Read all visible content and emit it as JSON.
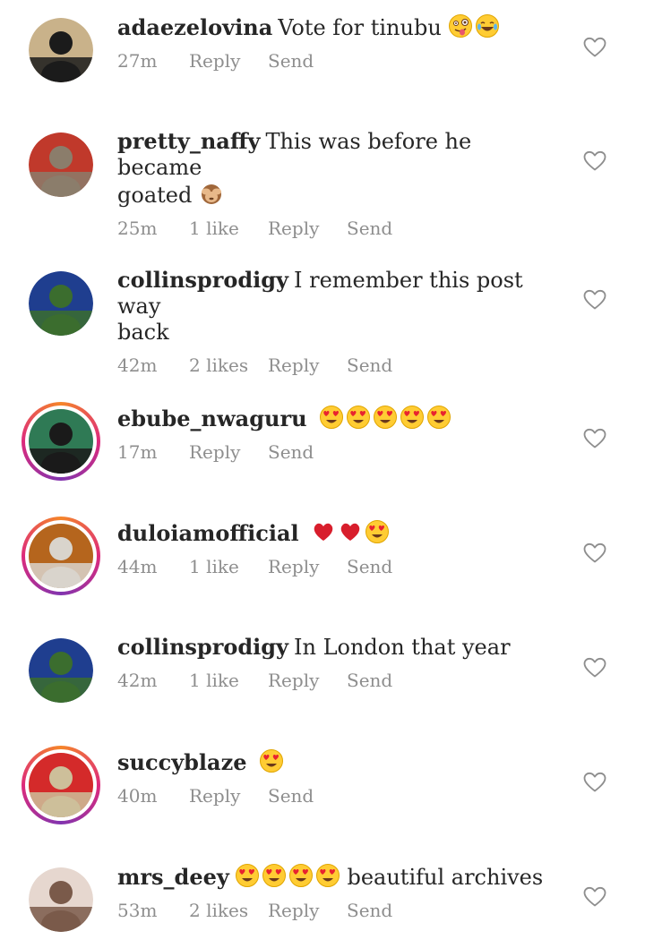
{
  "comments": [
    {
      "username": "adaezelovina",
      "text": "Vote for tinubu",
      "text_2": "",
      "emojis": [
        "zany",
        "joy"
      ],
      "time": "27m",
      "likes": "",
      "reply_label": "Reply",
      "send_label": "Send",
      "story_ring": false,
      "avatar_colors": [
        "#1b1b1b",
        "#c9b28a"
      ]
    },
    {
      "username": "pretty_naffy",
      "text": "This was before he became",
      "text_2": "goated",
      "emojis": [
        "see-no-evil"
      ],
      "time": "25m",
      "likes": "1 like",
      "reply_label": "Reply",
      "send_label": "Send",
      "story_ring": false,
      "avatar_colors": [
        "#8b7d6b",
        "#c0392b"
      ]
    },
    {
      "username": "collinsprodigy",
      "text": "I remember this post way",
      "text_2": "back",
      "emojis": [],
      "time": "42m",
      "likes": "2 likes",
      "reply_label": "Reply",
      "send_label": "Send",
      "story_ring": false,
      "avatar_colors": [
        "#3b6d2e",
        "#1f3e8f"
      ]
    },
    {
      "username": "ebube_nwaguru",
      "text": "",
      "text_2": "",
      "emojis": [
        "heart-eyes",
        "heart-eyes",
        "heart-eyes",
        "heart-eyes",
        "heart-eyes"
      ],
      "time": "17m",
      "likes": "",
      "reply_label": "Reply",
      "send_label": "Send",
      "story_ring": true,
      "avatar_colors": [
        "#1a1a1a",
        "#2f7a55"
      ]
    },
    {
      "username": "duloiamofficial",
      "text": "",
      "text_2": "",
      "emojis": [
        "red-heart",
        "red-heart",
        "heart-eyes"
      ],
      "time": "44m",
      "likes": "1 like",
      "reply_label": "Reply",
      "send_label": "Send",
      "story_ring": true,
      "avatar_colors": [
        "#d9d4cc",
        "#b5651d"
      ]
    },
    {
      "username": "collinsprodigy",
      "text": "In London that year",
      "text_2": "",
      "emojis": [],
      "time": "42m",
      "likes": "1 like",
      "reply_label": "Reply",
      "send_label": "Send",
      "story_ring": false,
      "avatar_colors": [
        "#3b6d2e",
        "#1f3e8f"
      ]
    },
    {
      "username": "succyblaze",
      "text": "",
      "text_2": "",
      "emojis": [
        "heart-eyes"
      ],
      "time": "40m",
      "likes": "",
      "reply_label": "Reply",
      "send_label": "Send",
      "story_ring": true,
      "avatar_colors": [
        "#cdbf9a",
        "#d42a2a"
      ]
    },
    {
      "username": "mrs_deey",
      "text": "beautiful archives",
      "text_2": "",
      "emojis_before_text": [
        "heart-eyes",
        "heart-eyes",
        "heart-eyes",
        "heart-eyes"
      ],
      "emojis": [],
      "time": "53m",
      "likes": "2 likes",
      "reply_label": "Reply",
      "send_label": "Send",
      "story_ring": false,
      "avatar_colors": [
        "#7a5a4a",
        "#e6d7cf"
      ]
    }
  ]
}
